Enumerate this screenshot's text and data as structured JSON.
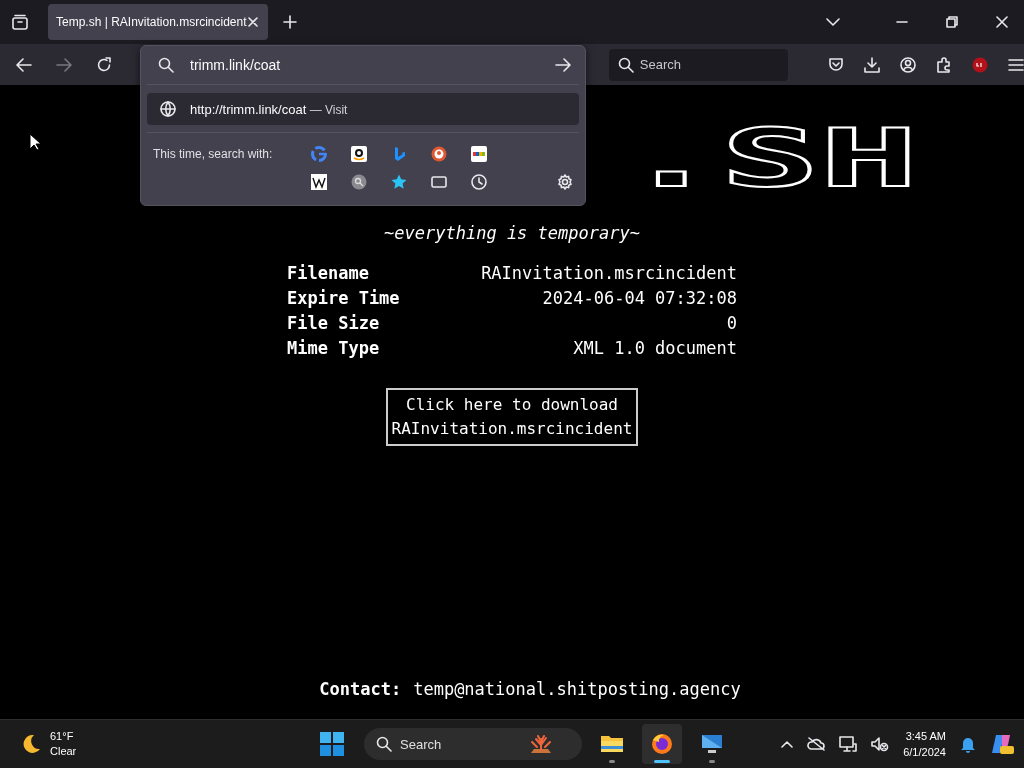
{
  "browser": {
    "tabs": [
      {
        "title": "Temp.sh | RAInvitation.msrcincident",
        "selected": true
      }
    ],
    "address_bar": {
      "value": "trimm.link/coat"
    },
    "url_dropdown": {
      "suggestion": {
        "url": "http://trimm.link/coat",
        "action": "— Visit",
        "selected": true
      },
      "search_label": "This time, search with:"
    },
    "search_field": {
      "placeholder": "Search"
    }
  },
  "page": {
    "logo": ".SH",
    "tagline": "~everything is temporary~",
    "details": [
      {
        "label": "Filename",
        "value": "RAInvitation.msrcincident"
      },
      {
        "label": "Expire Time",
        "value": "2024-06-04 07:32:08"
      },
      {
        "label": "File Size",
        "value": "0"
      },
      {
        "label": "Mime Type",
        "value": "XML 1.0 document"
      }
    ],
    "download_button": {
      "lines": [
        "Click here to download",
        "RAInvitation.msrcincident"
      ]
    },
    "contact": {
      "label": "Contact:",
      "email": "temp@national.shitposting.agency"
    }
  },
  "taskbar": {
    "weather": {
      "temperature": "61°F",
      "condition": "Clear"
    },
    "search": {
      "placeholder": "Search"
    },
    "apps": [
      {
        "kind": "explorer",
        "selected": false
      },
      {
        "kind": "firefox",
        "selected": true
      },
      {
        "kind": "remote",
        "selected": false
      }
    ],
    "clock": {
      "time": "3:45 AM",
      "date": "6/1/2024"
    }
  }
}
